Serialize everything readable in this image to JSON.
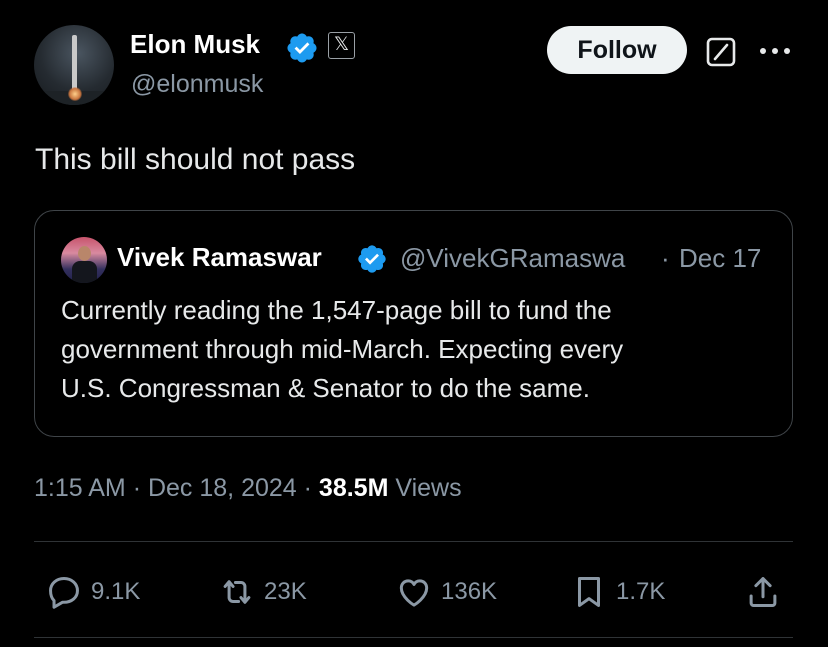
{
  "author": {
    "name": "Elon Musk",
    "handle": "@elonmusk",
    "affiliation_badge": "𝕏",
    "avatar_icon": "avatar-icon",
    "verified_color": "#1d9bf0"
  },
  "header": {
    "follow_label": "Follow",
    "grok_icon": "grok-icon",
    "more_icon": "more-icon"
  },
  "tweet": {
    "text": "This bill should not pass"
  },
  "quote": {
    "name": "Vivek Ramaswar",
    "handle": "@VivekGRamaswa",
    "separator": "·",
    "date": "Dec 17",
    "lines": [
      "Currently reading the 1,547-page bill to fund the",
      "government through mid-March. Expecting every",
      "U.S. Congressman & Senator to do the same."
    ]
  },
  "meta": {
    "time": "1:15 AM",
    "dot1": "·",
    "date": "Dec 18, 2024",
    "dot2": "·",
    "views_count": "38.5M",
    "views_label": "Views"
  },
  "actions": {
    "replies": "9.1K",
    "reposts": "23K",
    "likes": "136K",
    "bookmarks": "1.7K"
  },
  "colors": {
    "background": "#000000",
    "text": "#e7e9ea",
    "secondary": "#8b98a5",
    "border": "#2f3336",
    "accent": "#1d9bf0"
  }
}
